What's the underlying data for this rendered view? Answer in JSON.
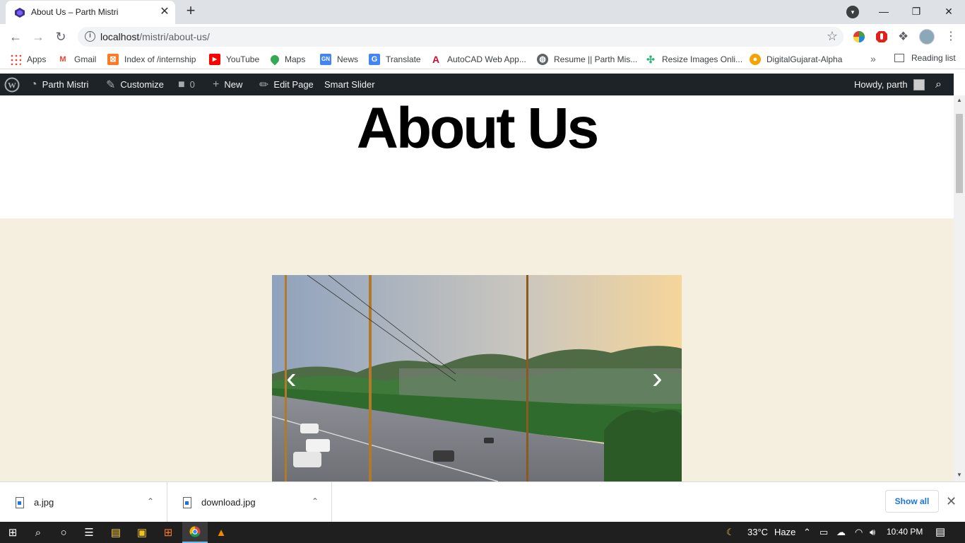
{
  "browser": {
    "tab_title": "About Us – Parth Mistri",
    "tab_close": "✕",
    "new_tab": "+",
    "url_host": "localhost",
    "url_path": "/mistri/about-us/",
    "reading_list": "Reading list",
    "bookmarks_more": "»"
  },
  "bookmarks": [
    {
      "label": "Apps",
      "icon": "apps-grid-icon",
      "color": "#4285f4"
    },
    {
      "label": "Gmail",
      "icon": "gmail-icon",
      "color": "#ea4335"
    },
    {
      "label": "Index of /internship",
      "icon": "xampp-icon",
      "color": "#fb7a24"
    },
    {
      "label": "YouTube",
      "icon": "youtube-icon",
      "color": "#ff0000"
    },
    {
      "label": "Maps",
      "icon": "maps-pin-icon",
      "color": "#34a853"
    },
    {
      "label": "News",
      "icon": "google-news-icon",
      "color": "#4285f4"
    },
    {
      "label": "Translate",
      "icon": "translate-icon",
      "color": "#4285f4"
    },
    {
      "label": "AutoCAD Web App...",
      "icon": "autocad-icon",
      "color": "#c8102e"
    },
    {
      "label": "Resume || Parth Mis...",
      "icon": "globe-icon",
      "color": "#5f6368"
    },
    {
      "label": "Resize Images Onli...",
      "icon": "resize-icon",
      "color": "#2bb673"
    },
    {
      "label": "DigitalGujarat-Alpha",
      "icon": "digitalgujarat-icon",
      "color": "#f4a300"
    }
  ],
  "wp_admin_bar": {
    "site_name": "Parth Mistri",
    "customize": "Customize",
    "comments_count": "0",
    "new": "New",
    "edit_page": "Edit Page",
    "smart_slider": "Smart Slider",
    "howdy": "Howdy, parth"
  },
  "page": {
    "title": "About Us",
    "cover_bg": "#f5efe0",
    "slider_prev": "‹",
    "slider_next": "›"
  },
  "downloads": [
    {
      "name": "a.jpg"
    },
    {
      "name": "download.jpg"
    }
  ],
  "shelf": {
    "show_all": "Show all"
  },
  "taskbar": {
    "temperature": "33°C",
    "weather": "Haze",
    "time": "10:40 PM"
  }
}
